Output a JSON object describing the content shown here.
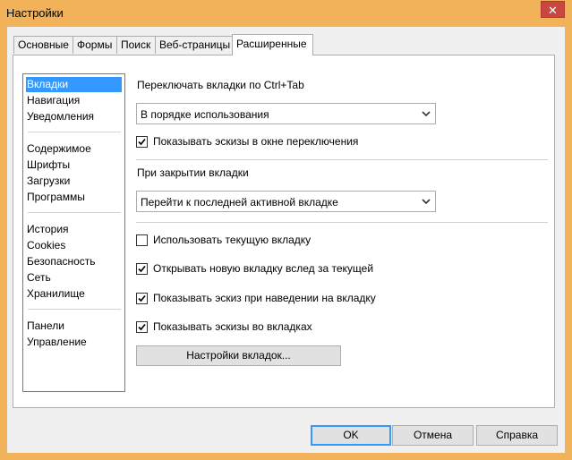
{
  "window": {
    "title": "Настройки",
    "close_glyph": "✕"
  },
  "tabs": [
    {
      "label": "Основные",
      "active": false
    },
    {
      "label": "Формы",
      "active": false
    },
    {
      "label": "Поиск",
      "active": false
    },
    {
      "label": "Веб-страницы",
      "active": false
    },
    {
      "label": "Расширенные",
      "active": true
    }
  ],
  "sidebar": {
    "groups": [
      [
        "Вкладки",
        "Навигация",
        "Уведомления"
      ],
      [
        "Содержимое",
        "Шрифты",
        "Загрузки",
        "Программы"
      ],
      [
        "История",
        "Cookies",
        "Безопасность",
        "Сеть",
        "Хранилище"
      ],
      [
        "Панели",
        "Управление"
      ]
    ],
    "selected": "Вкладки"
  },
  "main": {
    "switch_label": "Переключать вкладки по Ctrl+Tab",
    "switch_select": "В порядке использования",
    "show_thumbs_switch": {
      "label": "Показывать эскизы в окне переключения",
      "checked": true
    },
    "close_label": "При закрытии вкладки",
    "close_select": "Перейти к последней активной вкладке",
    "use_current": {
      "label": "Использовать текущую вкладку",
      "checked": false
    },
    "open_after": {
      "label": "Открывать новую вкладку вслед за текущей",
      "checked": true
    },
    "hover_thumb": {
      "label": "Показывать эскиз при наведении на вкладку",
      "checked": true
    },
    "tab_thumbs": {
      "label": "Показывать эскизы во вкладках",
      "checked": true
    },
    "tab_settings_button": "Настройки вкладок..."
  },
  "footer": {
    "ok": "OK",
    "cancel": "Отмена",
    "help": "Справка"
  },
  "colors": {
    "titlebar": "#f2b25a",
    "selection": "#3399ff",
    "close": "#c9473e"
  }
}
